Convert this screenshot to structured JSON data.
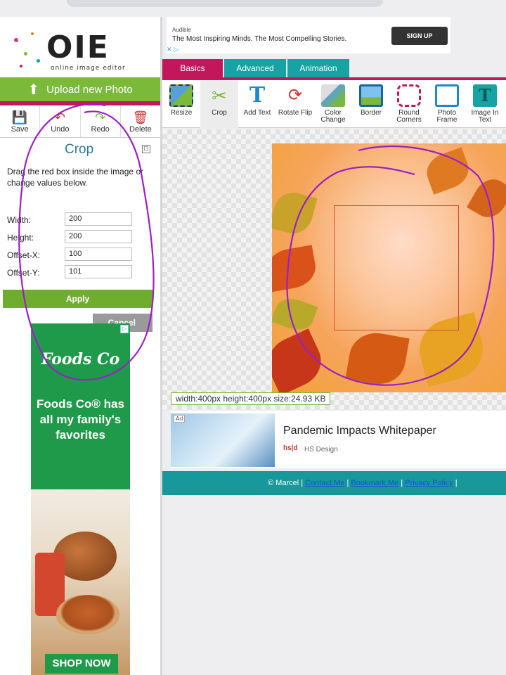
{
  "logo": {
    "text": "OIE",
    "subtitle": "online image editor"
  },
  "sidebar": {
    "upload_label": "Upload new Photo",
    "tools": [
      {
        "label": "Save",
        "icon": "save-icon"
      },
      {
        "label": "Undo",
        "icon": "undo-icon"
      },
      {
        "label": "Redo",
        "icon": "redo-icon"
      },
      {
        "label": "Delete",
        "icon": "delete-icon"
      }
    ]
  },
  "crop": {
    "title": "Crop",
    "description": "Drag the red box inside the image or change values below.",
    "fields": [
      {
        "label": "Width:",
        "value": "200"
      },
      {
        "label": "Height:",
        "value": "200"
      },
      {
        "label": "Offset-X:",
        "value": "100"
      },
      {
        "label": "Offset-Y:",
        "value": "101"
      }
    ],
    "apply_label": "Apply",
    "cancel_label": "Cancel"
  },
  "side_ad": {
    "brand": "Foods Co",
    "tagline": "Foods Co® has all my family's favorites",
    "cta": "SHOP NOW"
  },
  "top_ad": {
    "brand": "Audible",
    "headline": "The Most Inspiring Minds. The Most Compelling Stories.",
    "cta": "SIGN UP"
  },
  "tabs": [
    {
      "label": "Basics",
      "active": true
    },
    {
      "label": "Advanced",
      "active": false
    },
    {
      "label": "Animation",
      "active": false
    }
  ],
  "toolbar": [
    {
      "label": "Resize",
      "icon": "resize-icon"
    },
    {
      "label": "Crop",
      "icon": "crop-icon",
      "selected": true
    },
    {
      "label": "Add Text",
      "icon": "add-text-icon"
    },
    {
      "label": "Rotate Flip",
      "icon": "rotate-flip-icon"
    },
    {
      "label": "Color Change",
      "icon": "color-change-icon"
    },
    {
      "label": "Border",
      "icon": "border-icon"
    },
    {
      "label": "Round Corners",
      "icon": "round-corners-icon"
    },
    {
      "label": "Photo Frame",
      "icon": "photo-frame-icon"
    },
    {
      "label": "Image In Text",
      "icon": "image-in-text-icon"
    }
  ],
  "image_info": "width:400px height:400px size:24.93 KB",
  "bottom_ad": {
    "ad_label": "Ad",
    "title": "Pandemic Impacts Whitepaper",
    "source_logo": "hs|d",
    "source": "HS Design"
  },
  "footer": {
    "copyright": "© Marcel |",
    "links": [
      "Contact Me",
      "Bookmark Me",
      "Privacy Policy"
    ]
  },
  "colors": {
    "accent": "#c2185b",
    "teal": "#17a2a4",
    "green": "#7ab93a",
    "annotation": "#9c1fc4"
  }
}
